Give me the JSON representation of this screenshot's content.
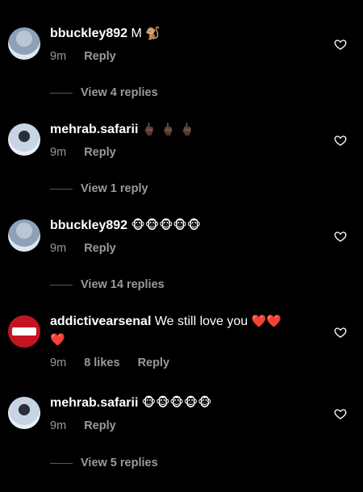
{
  "comments": [
    {
      "user": "bbuckley892",
      "text": "M",
      "emoji": "🐒",
      "time": "9m",
      "likes": "",
      "reply": "Reply",
      "view_replies": "View 4 replies"
    },
    {
      "user": "mehrab.safarii",
      "text": "",
      "emoji": "🖕🏿 🖕🏿 🖕🏿",
      "time": "9m",
      "likes": "",
      "reply": "Reply",
      "view_replies": "View 1 reply"
    },
    {
      "user": "bbuckley892",
      "text": "",
      "emoji": "🐵🐵🐵🐵🐵",
      "time": "9m",
      "likes": "",
      "reply": "Reply",
      "view_replies": "View 14 replies"
    },
    {
      "user": "addictivearsenal",
      "text": "We still love you",
      "emoji": "❤️❤️",
      "emoji2": "❤️",
      "time": "9m",
      "likes": "8 likes",
      "reply": "Reply",
      "view_replies": ""
    },
    {
      "user": "mehrab.safarii",
      "text": "",
      "emoji": "🐵🐵🐵🐵🐵",
      "time": "9m",
      "likes": "",
      "reply": "Reply",
      "view_replies": "View 5 replies"
    }
  ],
  "icons": {
    "like": "heart-outline-icon"
  },
  "colors": {
    "background": "#000000",
    "primary_text": "#ffffff",
    "secondary_text": "#9a9a9a",
    "heart_red": "#e8202e"
  }
}
